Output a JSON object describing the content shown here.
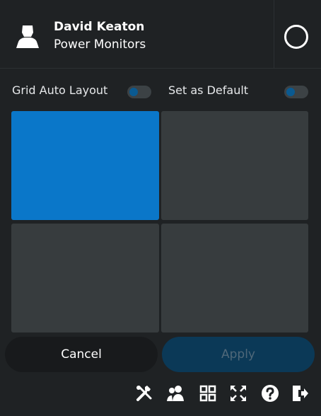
{
  "header": {
    "user_name": "David Keaton",
    "user_role": "Power Monitors",
    "avatar_icon": "user-silhouette-icon",
    "status_icon": "circle-icon"
  },
  "toggles": [
    {
      "label": "Grid Auto Layout",
      "on": false
    },
    {
      "label": "Set as Default",
      "on": false
    }
  ],
  "layout_grid": {
    "rows": 2,
    "columns": 2,
    "selected_cell": 0
  },
  "actions": {
    "cancel_label": "Cancel",
    "apply_label": "Apply"
  },
  "toolbar": {
    "icons": [
      "tools-icon",
      "users-icon",
      "grid-layout-icon",
      "fullscreen-icon",
      "help-icon",
      "logout-icon"
    ]
  },
  "colors": {
    "background": "#1f2224",
    "accent": "#0a77c9",
    "cell": "#373c3e",
    "apply_disabled": "#0b3957"
  }
}
